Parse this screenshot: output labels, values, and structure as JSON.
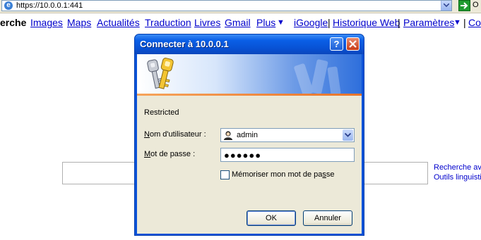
{
  "browser": {
    "url": "https://10.0.0.1:441",
    "go_label": "O"
  },
  "google_nav": {
    "current": "erche",
    "links": [
      "Images",
      "Maps",
      "Actualités",
      "Traduction",
      "Livres",
      "Gmail",
      "Plus"
    ],
    "plus_arrow": "▼",
    "right_links": [
      "iGoogle",
      "Historique Web",
      "Paramètres"
    ],
    "separator": "|",
    "settings_arrow": "▼",
    "cut_link": "Co"
  },
  "page": {
    "side_links": [
      "Recherche av",
      "Outils linguisti"
    ]
  },
  "dialog": {
    "title": "Connecter à 10.0.0.1",
    "help_label": "?",
    "realm": "Restricted",
    "username_label_prefix": "N",
    "username_label_rest": "om d'utilisateur :",
    "username_value": "admin",
    "password_label_prefix": "M",
    "password_label_rest": "ot de passe :",
    "password_value": "●●●●●●",
    "remember_label_prefix": "Mémoriser mon mot de pa",
    "remember_label_accel": "s",
    "remember_label_suffix": "se",
    "remember_checked": false,
    "ok_label": "OK",
    "cancel_label": "Annuler"
  },
  "colors": {
    "link": "#0000cc",
    "titlebar": "#0a5fe6",
    "dialog_bg": "#ece9d8"
  }
}
